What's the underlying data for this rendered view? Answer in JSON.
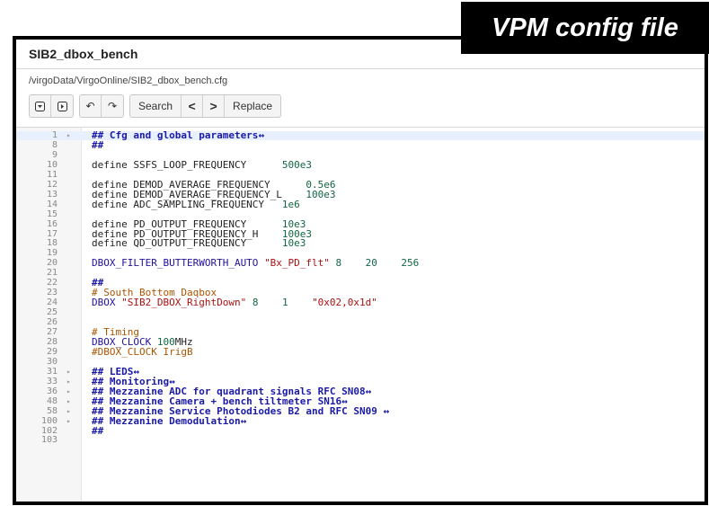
{
  "banner": "VPM config file",
  "header": {
    "title": "SIB2_dbox_bench"
  },
  "path": "/virgoData/VirgoOnline/SIB2_dbox_bench.cfg",
  "toolbar": {
    "search": "Search",
    "replace": "Replace",
    "prev": "<",
    "next": ">"
  },
  "lines": [
    {
      "n": "1",
      "fold": true,
      "parts": [
        [
          "hd",
          "## Cfg and global parameters"
        ],
        [
          "hd",
          "↔"
        ]
      ]
    },
    {
      "n": "8",
      "parts": [
        [
          "hd",
          "##"
        ]
      ]
    },
    {
      "n": "9",
      "parts": []
    },
    {
      "n": "10",
      "parts": [
        [
          "kw",
          "define SSFS_LOOP_FREQUENCY      "
        ],
        [
          "num",
          "500e3"
        ]
      ]
    },
    {
      "n": "11",
      "parts": []
    },
    {
      "n": "12",
      "parts": [
        [
          "kw",
          "define DEMOD_AVERAGE_FREQUENCY      "
        ],
        [
          "num",
          "0.5e6"
        ]
      ]
    },
    {
      "n": "13",
      "parts": [
        [
          "kw",
          "define DEMOD_AVERAGE_FREQUENCY_L    "
        ],
        [
          "num",
          "100e3"
        ]
      ]
    },
    {
      "n": "14",
      "parts": [
        [
          "kw",
          "define ADC_SAMPLING_FREQUENCY   "
        ],
        [
          "num",
          "1e6"
        ]
      ]
    },
    {
      "n": "15",
      "parts": []
    },
    {
      "n": "16",
      "parts": [
        [
          "kw",
          "define PD_OUTPUT_FREQUENCY      "
        ],
        [
          "num",
          "10e3"
        ]
      ]
    },
    {
      "n": "17",
      "parts": [
        [
          "kw",
          "define PD_OUTPUT_FREQUENCY_H    "
        ],
        [
          "num",
          "100e3"
        ]
      ]
    },
    {
      "n": "18",
      "parts": [
        [
          "kw",
          "define QD_OUTPUT_FREQUENCY      "
        ],
        [
          "num",
          "10e3"
        ]
      ]
    },
    {
      "n": "19",
      "parts": []
    },
    {
      "n": "20",
      "parts": [
        [
          "blue",
          "DBOX_FILTER_BUTTERWORTH_AUTO "
        ],
        [
          "str",
          "\"Bx_PD_flt\""
        ],
        [
          "num",
          " 8    20    256"
        ]
      ]
    },
    {
      "n": "21",
      "parts": []
    },
    {
      "n": "22",
      "parts": [
        [
          "hd",
          "##"
        ]
      ]
    },
    {
      "n": "23",
      "parts": [
        [
          "cm",
          "# South Bottom Daqbox"
        ]
      ]
    },
    {
      "n": "24",
      "parts": [
        [
          "blue",
          "DBOX "
        ],
        [
          "str",
          "\"SIB2_DBOX_RightDown\""
        ],
        [
          "num",
          " 8    1    "
        ],
        [
          "str",
          "\"0x02,0x1d\""
        ]
      ]
    },
    {
      "n": "25",
      "parts": []
    },
    {
      "n": "26",
      "parts": []
    },
    {
      "n": "27",
      "parts": [
        [
          "cm",
          "# Timing"
        ]
      ]
    },
    {
      "n": "28",
      "parts": [
        [
          "blue",
          "DBOX_CLOCK "
        ],
        [
          "num",
          "100"
        ],
        [
          "kw",
          "MHz"
        ]
      ]
    },
    {
      "n": "29",
      "parts": [
        [
          "cm",
          "#DBOX_CLOCK IrigB"
        ]
      ]
    },
    {
      "n": "30",
      "parts": []
    },
    {
      "n": "31",
      "fold": true,
      "parts": [
        [
          "hd",
          "## LEDS"
        ],
        [
          "hd",
          "↔"
        ]
      ]
    },
    {
      "n": "33",
      "fold": true,
      "parts": [
        [
          "hd",
          "## Monitoring"
        ],
        [
          "hd",
          "↔"
        ]
      ]
    },
    {
      "n": "36",
      "fold": true,
      "parts": [
        [
          "hd",
          "## Mezzanine ADC for quadrant signals RFC SN08"
        ],
        [
          "hd",
          "↔"
        ]
      ]
    },
    {
      "n": "48",
      "fold": true,
      "parts": [
        [
          "hd",
          "## Mezzanine Camera + bench tiltmeter SN16"
        ],
        [
          "hd",
          "↔"
        ]
      ]
    },
    {
      "n": "58",
      "fold": true,
      "parts": [
        [
          "hd",
          "## Mezzanine Service Photodiodes B2 and RFC SN09 "
        ],
        [
          "hd",
          "↔"
        ]
      ]
    },
    {
      "n": "100",
      "fold": true,
      "parts": [
        [
          "hd",
          "## Mezzanine Demodulation"
        ],
        [
          "hd",
          "↔"
        ]
      ]
    },
    {
      "n": "102",
      "parts": [
        [
          "hd",
          "##"
        ]
      ]
    },
    {
      "n": "103",
      "parts": []
    }
  ]
}
